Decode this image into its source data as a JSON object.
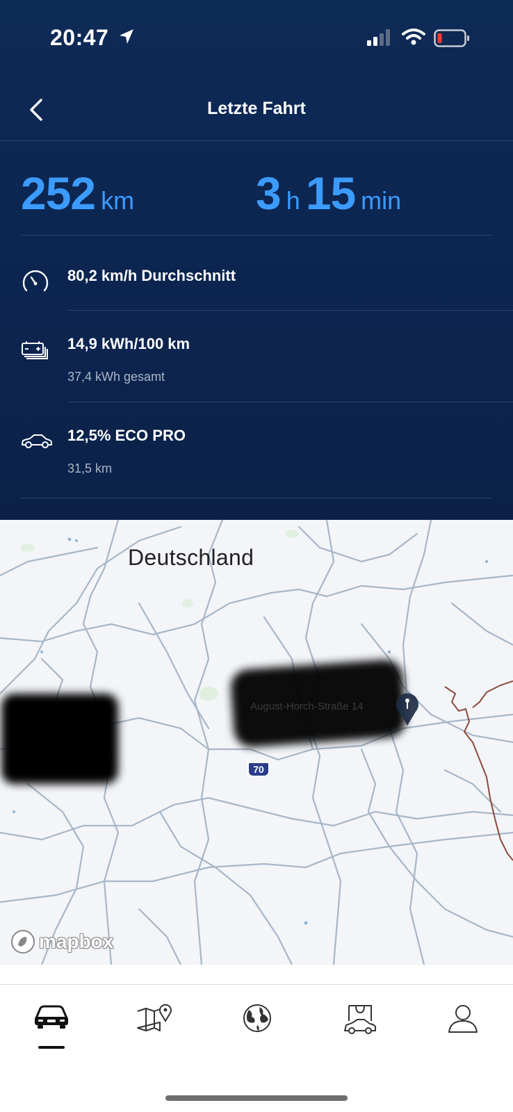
{
  "status_bar": {
    "time": "20:47"
  },
  "header": {
    "title": "Letzte Fahrt"
  },
  "summary": {
    "distance_value": "252",
    "distance_unit": "km",
    "duration_hours": "3",
    "duration_hours_unit": "h",
    "duration_minutes": "15",
    "duration_minutes_unit": "min"
  },
  "details": [
    {
      "icon": "speedometer-icon",
      "title": "80,2 km/h Durchschnitt",
      "subtitle": ""
    },
    {
      "icon": "battery-stack-icon",
      "title": "14,9 kWh/100 km",
      "subtitle": "37,4 kWh gesamt"
    },
    {
      "icon": "car-icon",
      "title": "12,5% ECO PRO",
      "subtitle": "31,5 km"
    }
  ],
  "map": {
    "country_label": "Deutschland",
    "street_label": "August-Horch-Straße 14",
    "highway_shield": "70",
    "attribution": "mapbox"
  },
  "tabs": [
    {
      "icon": "car-front-icon",
      "active": true
    },
    {
      "icon": "map-pin-icon",
      "active": false
    },
    {
      "icon": "globe-icon",
      "active": false
    },
    {
      "icon": "shop-car-icon",
      "active": false
    },
    {
      "icon": "profile-icon",
      "active": false
    }
  ],
  "colors": {
    "header_bg": "#0c2550",
    "accent_blue": "#3c9bff",
    "map_bg": "#f3f5f8",
    "road": "#9fb0c4",
    "border": "#8a4a3a"
  }
}
